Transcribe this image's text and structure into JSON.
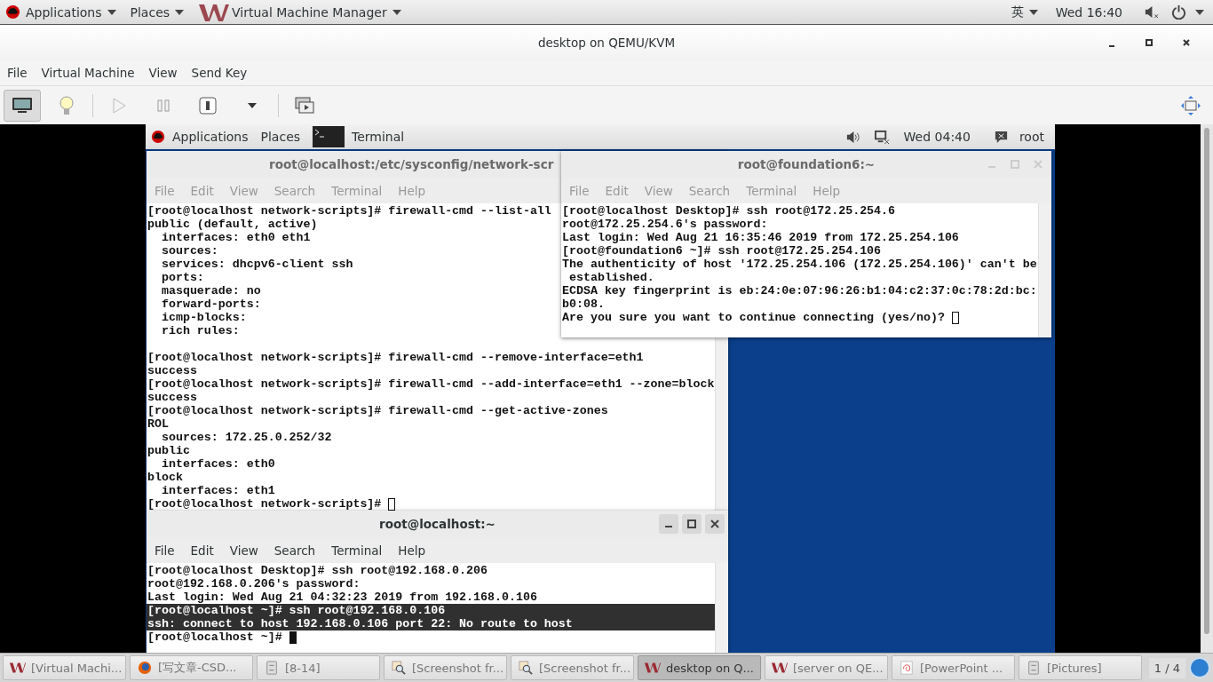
{
  "top_bar": {
    "menus": [
      {
        "label": "Applications",
        "kind": "redhat"
      },
      {
        "label": "Places",
        "kind": "plain"
      },
      {
        "label": "Virtual Machine Manager",
        "kind": "vmm"
      }
    ],
    "input_method": "英",
    "clock": "Wed 16:40"
  },
  "window": {
    "title": "desktop on QEMU/KVM"
  },
  "menu_bar": [
    "File",
    "Virtual Machine",
    "View",
    "Send Key"
  ],
  "toolbar": [
    {
      "kind": "console",
      "selected": true
    },
    {
      "kind": "details",
      "selected": false
    },
    {
      "kind": "run",
      "selected": false
    },
    {
      "kind": "pause",
      "selected": false
    },
    {
      "kind": "shutdown",
      "selected": false
    },
    {
      "kind": "shutdown-menu",
      "selected": false
    },
    {
      "kind": "snapshots",
      "selected": false
    },
    {
      "kind": "fullscreen",
      "selected": false
    }
  ],
  "guest": {
    "top_bar": {
      "applications": "Applications",
      "places": "Places",
      "task": "Terminal",
      "clock": "Wed 04:40",
      "user": "root"
    },
    "terminals": [
      {
        "title": "root@localhost:/etc/sysconfig/network-scr",
        "active": false,
        "menus": [
          "File",
          "Edit",
          "View",
          "Search",
          "Terminal",
          "Help"
        ],
        "cursor_filled": false,
        "lines": [
          {
            "kind": "text",
            "text": "[root@localhost network-scripts]# firewall-cmd --list-all",
            "highlighted": false
          },
          {
            "kind": "text",
            "text": "public (default, active)",
            "highlighted": false
          },
          {
            "kind": "text",
            "text": "  interfaces: eth0 eth1",
            "highlighted": false
          },
          {
            "kind": "text",
            "text": "  sources:",
            "highlighted": false
          },
          {
            "kind": "text",
            "text": "  services: dhcpv6-client ssh",
            "highlighted": false
          },
          {
            "kind": "text",
            "text": "  ports:",
            "highlighted": false
          },
          {
            "kind": "text",
            "text": "  masquerade: no",
            "highlighted": false
          },
          {
            "kind": "text",
            "text": "  forward-ports:",
            "highlighted": false
          },
          {
            "kind": "text",
            "text": "  icmp-blocks:",
            "highlighted": false
          },
          {
            "kind": "text",
            "text": "  rich rules:",
            "highlighted": false
          },
          {
            "kind": "blank"
          },
          {
            "kind": "text",
            "text": "[root@localhost network-scripts]# firewall-cmd --remove-interface=eth1",
            "highlighted": false
          },
          {
            "kind": "text",
            "text": "success",
            "highlighted": false
          },
          {
            "kind": "text",
            "text": "[root@localhost network-scripts]# firewall-cmd --add-interface=eth1 --zone=block",
            "highlighted": false
          },
          {
            "kind": "text",
            "text": "success",
            "highlighted": false
          },
          {
            "kind": "text",
            "text": "[root@localhost network-scripts]# firewall-cmd --get-active-zones",
            "highlighted": false
          },
          {
            "kind": "text",
            "text": "ROL",
            "highlighted": false
          },
          {
            "kind": "text",
            "text": "  sources: 172.25.0.252/32",
            "highlighted": false
          },
          {
            "kind": "text",
            "text": "public",
            "highlighted": false
          },
          {
            "kind": "text",
            "text": "  interfaces: eth0",
            "highlighted": false
          },
          {
            "kind": "text",
            "text": "block",
            "highlighted": false
          },
          {
            "kind": "text",
            "text": "  interfaces: eth1",
            "highlighted": false
          },
          {
            "kind": "text",
            "text": "[root@localhost network-scripts]# ",
            "highlighted": false
          }
        ]
      },
      {
        "title": "root@foundation6:~",
        "active": false,
        "menus": [
          "File",
          "Edit",
          "View",
          "Search",
          "Terminal",
          "Help"
        ],
        "cursor_filled": false,
        "lines": [
          {
            "kind": "text",
            "text": "[root@localhost Desktop]# ssh root@172.25.254.6",
            "highlighted": false
          },
          {
            "kind": "text",
            "text": "root@172.25.254.6's password:",
            "highlighted": false
          },
          {
            "kind": "text",
            "text": "Last login: Wed Aug 21 16:35:46 2019 from 172.25.254.106",
            "highlighted": false
          },
          {
            "kind": "text",
            "text": "[root@foundation6 ~]# ssh root@172.25.254.106",
            "highlighted": false
          },
          {
            "kind": "text",
            "text": "The authenticity of host '172.25.254.106 (172.25.254.106)' can't be",
            "highlighted": false
          },
          {
            "kind": "text",
            "text": " established.",
            "highlighted": false
          },
          {
            "kind": "text",
            "text": "ECDSA key fingerprint is eb:24:0e:07:96:26:b1:04:c2:37:0c:78:2d:bc:",
            "highlighted": false
          },
          {
            "kind": "text",
            "text": "b0:08.",
            "highlighted": false
          },
          {
            "kind": "text",
            "text": "Are you sure you want to continue connecting (yes/no)? ",
            "highlighted": false
          }
        ]
      },
      {
        "title": "root@localhost:~",
        "active": true,
        "menus": [
          "File",
          "Edit",
          "View",
          "Search",
          "Terminal",
          "Help"
        ],
        "cursor_filled": true,
        "lines": [
          {
            "kind": "text",
            "text": "[root@localhost Desktop]# ssh root@192.168.0.206",
            "highlighted": false
          },
          {
            "kind": "text",
            "text": "root@192.168.0.206's password:",
            "highlighted": false
          },
          {
            "kind": "text",
            "text": "Last login: Wed Aug 21 04:32:23 2019 from 192.168.0.106",
            "highlighted": false
          },
          {
            "kind": "text",
            "text": "[root@localhost ~]# ssh root@192.168.0.106",
            "highlighted": true
          },
          {
            "kind": "text",
            "text": "ssh: connect to host 192.168.0.106 port 22: No route to host",
            "highlighted": true
          },
          {
            "kind": "text",
            "text": "[root@localhost ~]# ",
            "highlighted": false
          }
        ]
      }
    ]
  },
  "taskbar": {
    "items": [
      {
        "label": "[Virtual Machi...",
        "kind": "vmm",
        "selected": false
      },
      {
        "label": "[写文章-CSD...",
        "kind": "browser",
        "selected": false
      },
      {
        "label": "[8-14]",
        "kind": "files",
        "selected": false
      },
      {
        "label": "[Screenshot fr...",
        "kind": "screenshot",
        "selected": false
      },
      {
        "label": "[Screenshot fr...",
        "kind": "screenshot",
        "selected": false
      },
      {
        "label": "desktop on Q...",
        "kind": "vmm",
        "selected": true
      },
      {
        "label": "[server on QE...",
        "kind": "vmm",
        "selected": false
      },
      {
        "label": "[PowerPoint ...",
        "kind": "presentation",
        "selected": false
      },
      {
        "label": "[Pictures]",
        "kind": "files",
        "selected": false
      }
    ],
    "pager": "1 / 4"
  }
}
